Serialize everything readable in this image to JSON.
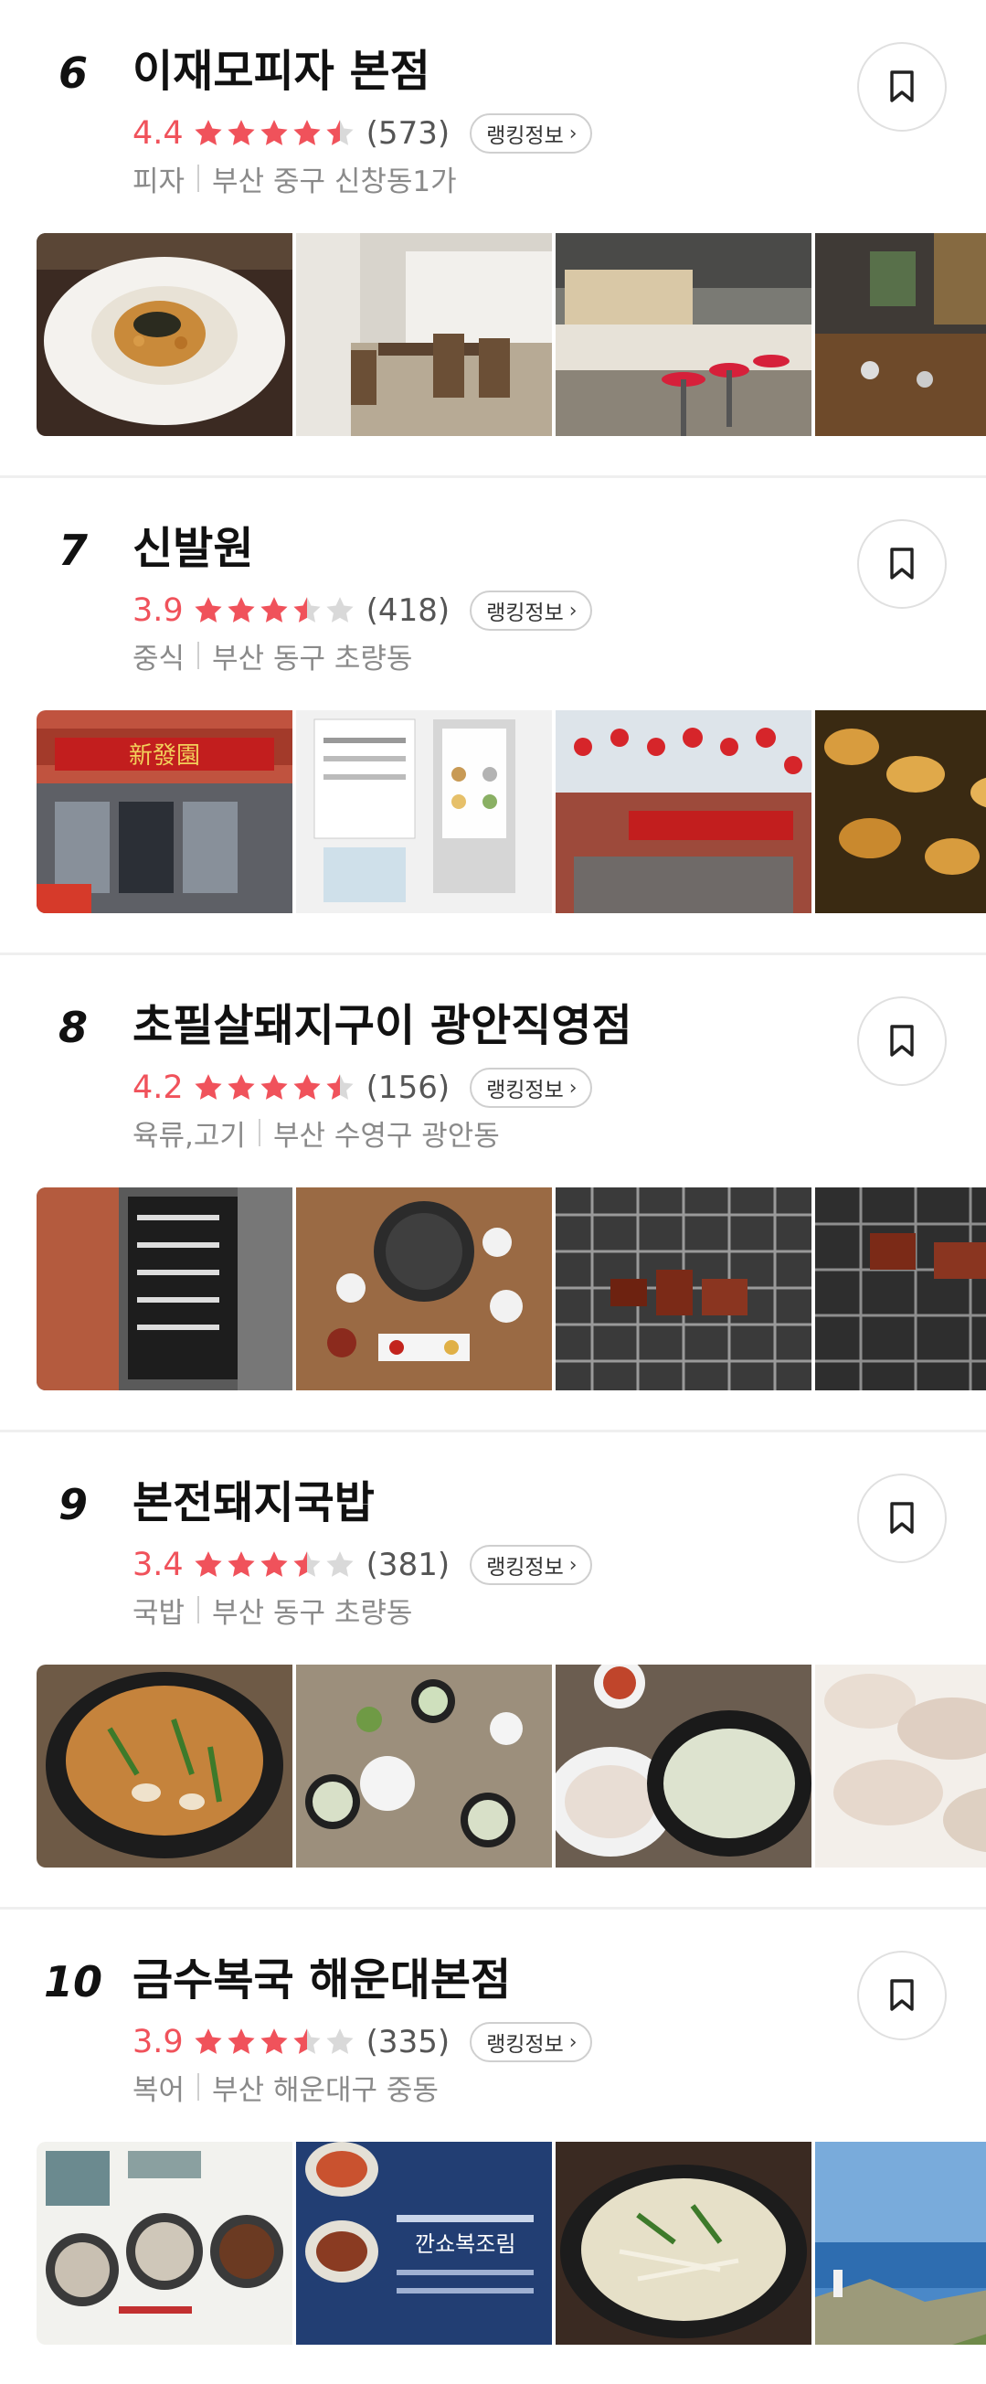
{
  "restaurants": [
    {
      "rank": "6",
      "name": "이재모피자 본점",
      "score": "4.4",
      "stars": [
        1,
        1,
        1,
        1,
        0.5
      ],
      "count": "(573)",
      "ranking_label": "랭킹정보",
      "category": "피자",
      "location": "부산 중구 신창동1가",
      "photos": [
        {
          "name": "pasta-dish-photo",
          "theme": "pasta"
        },
        {
          "name": "dining-room-photo",
          "theme": "interior"
        },
        {
          "name": "counter-bar-photo",
          "theme": "bar"
        },
        {
          "name": "lounge-photo",
          "theme": "lounge"
        }
      ]
    },
    {
      "rank": "7",
      "name": "신발원",
      "score": "3.9",
      "stars": [
        1,
        1,
        1,
        0.5,
        0
      ],
      "count": "(418)",
      "ranking_label": "랭킹정보",
      "category": "중식",
      "location": "부산 동구 초량동",
      "photos": [
        {
          "name": "storefront-photo",
          "theme": "storefront"
        },
        {
          "name": "menu-kiosk-photo",
          "theme": "kiosk"
        },
        {
          "name": "lanterns-street-photo",
          "theme": "lanterns"
        },
        {
          "name": "dumplings-photo",
          "theme": "dumplings"
        }
      ]
    },
    {
      "rank": "8",
      "name": "초필살돼지구이 광안직영점",
      "score": "4.2",
      "stars": [
        1,
        1,
        1,
        1,
        0.5
      ],
      "count": "(156)",
      "ranking_label": "랭킹정보",
      "category": "육류,고기",
      "location": "부산 수영구 광안동",
      "photos": [
        {
          "name": "menu-board-photo",
          "theme": "board"
        },
        {
          "name": "table-setting-photo",
          "theme": "table"
        },
        {
          "name": "grill-meat-photo",
          "theme": "grill"
        },
        {
          "name": "grill-closeup-photo",
          "theme": "grill2"
        }
      ]
    },
    {
      "rank": "9",
      "name": "본전돼지국밥",
      "score": "3.4",
      "stars": [
        1,
        1,
        1,
        0.5,
        0
      ],
      "count": "(381)",
      "ranking_label": "랭킹정보",
      "category": "국밥",
      "location": "부산 동구 초량동",
      "photos": [
        {
          "name": "soup-bowl-photo",
          "theme": "soup"
        },
        {
          "name": "meal-spread-photo",
          "theme": "spread"
        },
        {
          "name": "pork-and-soup-photo",
          "theme": "pork"
        },
        {
          "name": "sliced-pork-photo",
          "theme": "slices"
        }
      ]
    },
    {
      "rank": "10",
      "name": "금수복국 해운대본점",
      "score": "3.9",
      "stars": [
        1,
        1,
        1,
        0.5,
        0
      ],
      "count": "(335)",
      "ranking_label": "랭킹정보",
      "category": "복어",
      "location": "부산 해운대구 중동",
      "photos": [
        {
          "name": "menu-page-photo",
          "theme": "menupage"
        },
        {
          "name": "menu-blue-photo",
          "theme": "menublue"
        },
        {
          "name": "pufferfish-soup-photo",
          "theme": "clearsoup"
        },
        {
          "name": "coast-view-photo",
          "theme": "coast"
        }
      ],
      "photo_texts": [
        "깐쇼복조림"
      ]
    }
  ],
  "colors": {
    "accent": "#f0525b",
    "star_empty": "#d9d9d9",
    "meta": "#8a8a8a"
  }
}
